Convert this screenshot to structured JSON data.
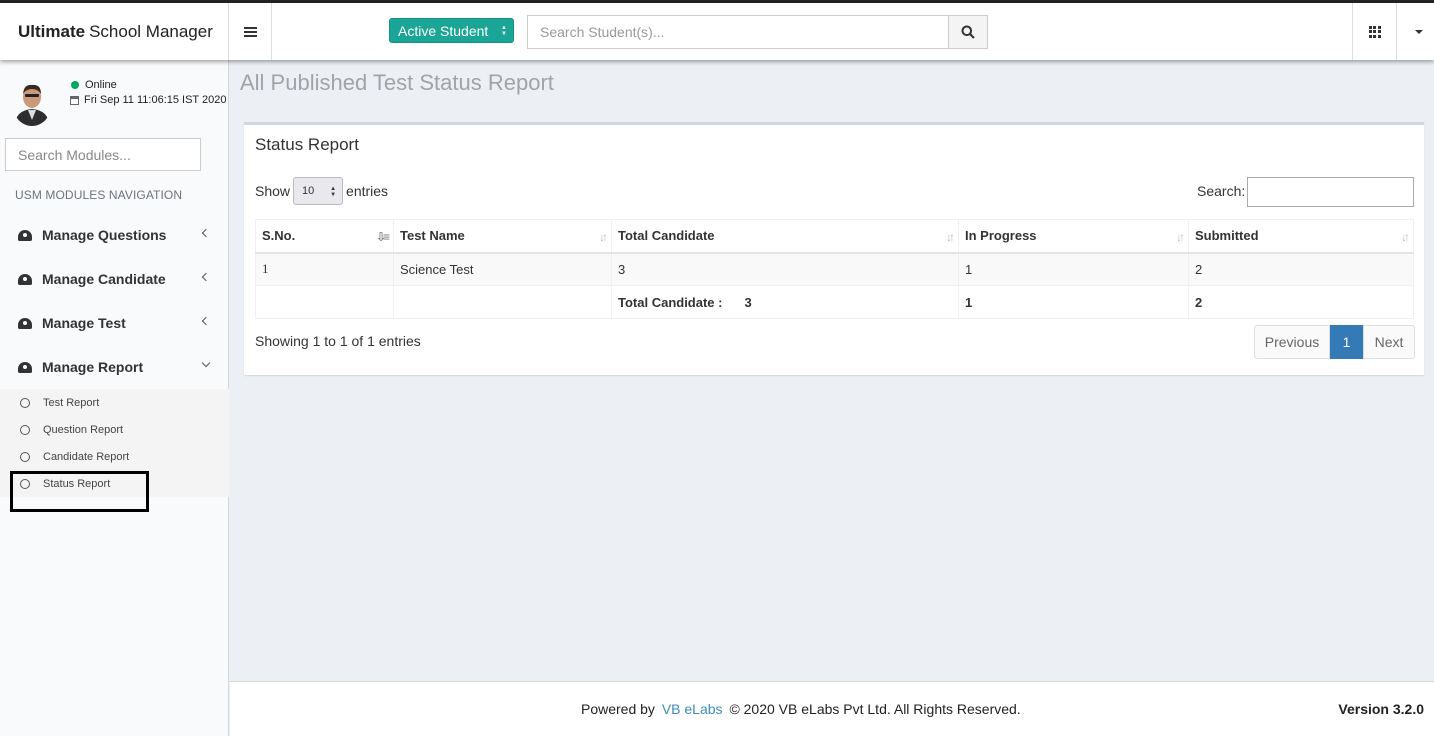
{
  "header": {
    "brand_bold": "Ultimate",
    "brand_rest": "School Manager",
    "student_select": "Active Student",
    "search_placeholder": "Search Student(s)..."
  },
  "sidebar": {
    "status": "Online",
    "datetime": "Fri Sep 11 11:06:15 IST 2020",
    "module_search_placeholder": "Search Modules...",
    "nav_header": "USM MODULES NAVIGATION",
    "menu": [
      {
        "label": "Manage Questions"
      },
      {
        "label": "Manage Candidate"
      },
      {
        "label": "Manage Test"
      },
      {
        "label": "Manage Report"
      }
    ],
    "submenu": [
      {
        "label": "Test Report"
      },
      {
        "label": "Question Report"
      },
      {
        "label": "Candidate Report"
      },
      {
        "label": "Status Report"
      }
    ]
  },
  "page": {
    "title": "All Published Test Status Report",
    "box_title": "Status Report",
    "show_label": "Show",
    "page_length": "10",
    "entries_label": "entries",
    "search_label": "Search:",
    "columns": [
      "S.No.",
      "Test Name",
      "Total Candidate",
      "In Progress",
      "Submitted"
    ],
    "rows": [
      {
        "sno": "1",
        "test_name": "Science Test",
        "total": "3",
        "in_progress": "1",
        "submitted": "2"
      }
    ],
    "totals": {
      "label": "Total Candidate :",
      "total": "3",
      "in_progress": "1",
      "submitted": "2"
    },
    "info": "Showing 1 to 1 of 1 entries",
    "pagination": {
      "previous": "Previous",
      "current": "1",
      "next": "Next"
    }
  },
  "footer": {
    "powered_by": "Powered by",
    "company_link": "VB eLabs",
    "copyright": "© 2020 VB eLabs Pvt Ltd. All Rights Reserved.",
    "version": "Version 3.2.0"
  }
}
